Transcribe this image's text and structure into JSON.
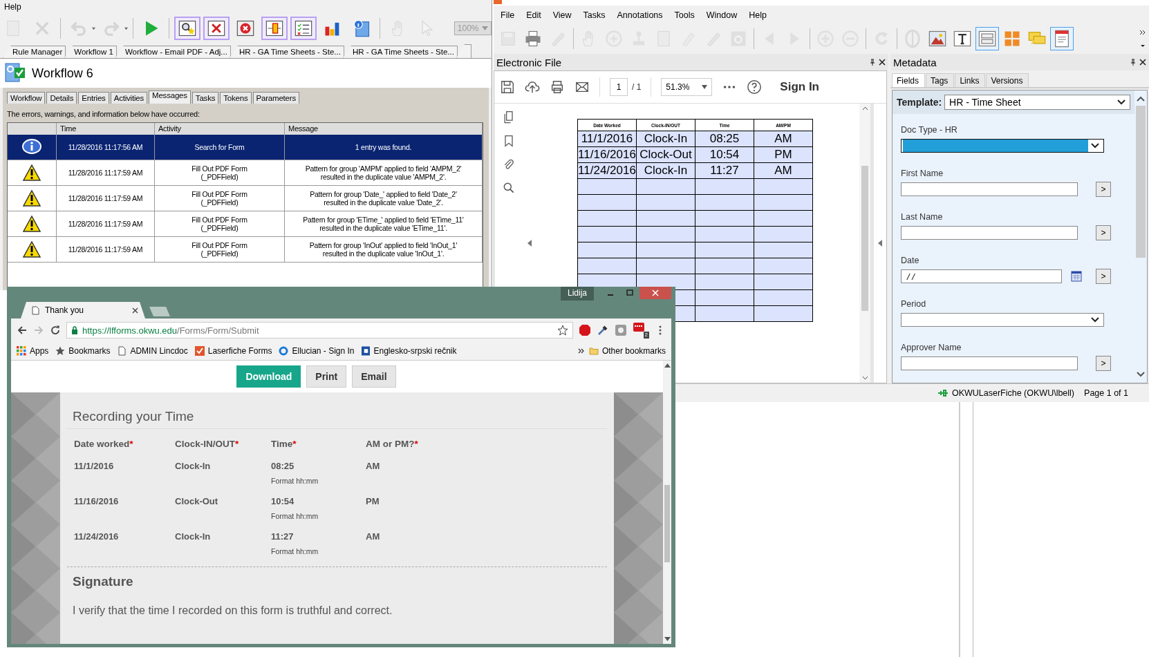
{
  "workflow_window": {
    "menu": [
      "Help"
    ],
    "toolbar": [
      {
        "kind": "page",
        "disabled": true,
        "active": false
      },
      {
        "kind": "cross",
        "disabled": true,
        "active": false
      },
      {
        "kind": "separator"
      },
      {
        "kind": "undo",
        "disabled": true,
        "active": false
      },
      {
        "kind": "redo",
        "disabled": true,
        "active": false
      },
      {
        "kind": "separator"
      },
      {
        "kind": "play",
        "disabled": false,
        "active": false
      },
      {
        "kind": "separator"
      },
      {
        "kind": "find",
        "disabled": false,
        "active": true
      },
      {
        "kind": "tools",
        "disabled": false,
        "active": true
      },
      {
        "kind": "stop",
        "disabled": false,
        "active": false
      },
      {
        "kind": "flow",
        "disabled": false,
        "active": true
      },
      {
        "kind": "checklist",
        "disabled": false,
        "active": true
      },
      {
        "kind": "chart",
        "disabled": false,
        "active": false
      },
      {
        "kind": "info",
        "disabled": false,
        "active": false
      },
      {
        "kind": "separator"
      },
      {
        "kind": "hand",
        "disabled": true,
        "active": false
      },
      {
        "kind": "pointer",
        "disabled": true,
        "active": false
      }
    ],
    "zoom": "100%",
    "doc_tabs": [
      "Rule Manager",
      "Workflow 1",
      "Workflow - Email PDF - Adj...",
      "HR - GA Time Sheets - Ste...",
      "HR - GA Time Sheets - Ste..."
    ],
    "title": "Workflow 6",
    "tabs": [
      {
        "label": "Workflow",
        "selected": false
      },
      {
        "label": "Details",
        "selected": false
      },
      {
        "label": "Entries",
        "selected": false
      },
      {
        "label": "Activities",
        "selected": false
      },
      {
        "label": "Messages",
        "selected": true
      },
      {
        "label": "Tasks",
        "selected": false
      },
      {
        "label": "Tokens",
        "selected": false
      },
      {
        "label": "Parameters",
        "selected": false
      }
    ],
    "notice": "The errors, warnings, and information below have occurred:",
    "table": {
      "columns": [
        "Time",
        "Activity",
        "Message"
      ],
      "rows": [
        {
          "kind": "info",
          "selected": true,
          "time": "11/28/2016 11:17:56 AM",
          "activity": "Search for Form",
          "message": "1 entry was found."
        },
        {
          "kind": "warning",
          "selected": false,
          "time": "11/28/2016 11:17:59 AM",
          "activity": "Fill Out PDF Form\n(_PDFField)",
          "message": "Pattern for group 'AMPM' applied to field 'AMPM_2'\nresulted in the duplicate value 'AMPM_2'."
        },
        {
          "kind": "warning",
          "selected": false,
          "time": "11/28/2016 11:17:59 AM",
          "activity": "Fill Out PDF Form\n(_PDFField)",
          "message": "Pattern for group 'Date_' applied to field 'Date_2'\nresulted in the duplicate value 'Date_2'."
        },
        {
          "kind": "warning",
          "selected": false,
          "time": "11/28/2016 11:17:59 AM",
          "activity": "Fill Out PDF Form\n(_PDFField)",
          "message": "Pattern for group 'ETime_' applied to field 'ETime_11'\nresulted in the duplicate value 'ETime_11'."
        },
        {
          "kind": "warning",
          "selected": false,
          "time": "11/28/2016 11:17:59 AM",
          "activity": "Fill Out PDF Form\n(_PDFField)",
          "message": "Pattern for group 'InOut' applied to field 'InOut_1'\nresulted in the duplicate value 'InOut_1'."
        }
      ]
    }
  },
  "laserfiche_window": {
    "menu": [
      "File",
      "Edit",
      "View",
      "Tasks",
      "Annotations",
      "Tools",
      "Window",
      "Help"
    ],
    "toolbar": [
      {
        "kind": "save",
        "disabled": true,
        "active": false
      },
      {
        "kind": "print",
        "disabled": false,
        "active": false
      },
      {
        "kind": "pencil",
        "disabled": true,
        "active": false
      },
      {
        "kind": "separator"
      },
      {
        "kind": "hand",
        "disabled": true,
        "active": false
      },
      {
        "kind": "zoomin",
        "disabled": true,
        "active": false
      },
      {
        "kind": "stamp",
        "disabled": true,
        "active": false
      },
      {
        "kind": "page",
        "disabled": true,
        "active": false
      },
      {
        "kind": "highlighter",
        "disabled": true,
        "active": false
      },
      {
        "kind": "pencil",
        "disabled": true,
        "active": false
      },
      {
        "kind": "textbox",
        "disabled": true,
        "active": false
      },
      {
        "kind": "separator"
      },
      {
        "kind": "back",
        "disabled": true,
        "active": false
      },
      {
        "kind": "forward",
        "disabled": true,
        "active": false
      },
      {
        "kind": "separator"
      },
      {
        "kind": "plus",
        "disabled": true,
        "active": false
      },
      {
        "kind": "minus",
        "disabled": true,
        "active": false
      },
      {
        "kind": "separator"
      },
      {
        "kind": "rotate",
        "disabled": true,
        "active": false
      },
      {
        "kind": "separator"
      },
      {
        "kind": "oval",
        "disabled": true,
        "active": false
      },
      {
        "kind": "picture",
        "disabled": false,
        "active": false
      },
      {
        "kind": "text",
        "disabled": false,
        "active": false
      },
      {
        "kind": "fields",
        "disabled": false,
        "active": true
      },
      {
        "kind": "tiles",
        "disabled": false,
        "active": false
      },
      {
        "kind": "comments",
        "disabled": false,
        "active": false
      },
      {
        "kind": "document",
        "disabled": false,
        "active": true
      }
    ],
    "electronic_file": {
      "title": "Electronic File",
      "page": "1",
      "page_total": "/ 1",
      "zoom": "51.3%",
      "sign_in": "Sign In",
      "pdf_table": {
        "columns": [
          "Date Worked",
          "Clock-IN/OUT",
          "Time",
          "AM/PM"
        ],
        "rows": [
          [
            "11/1/2016",
            "Clock-In",
            "08:25",
            "AM"
          ],
          [
            "11/16/2016",
            "Clock-Out",
            "10:54",
            "PM"
          ],
          [
            "11/24/2016",
            "Clock-In",
            "11:27",
            "AM"
          ]
        ]
      }
    },
    "metadata": {
      "title": "Metadata",
      "tabs": [
        {
          "label": "Fields",
          "selected": true
        },
        {
          "label": "Tags",
          "selected": false
        },
        {
          "label": "Links",
          "selected": false
        },
        {
          "label": "Versions",
          "selected": false
        }
      ],
      "template_label": "Template:",
      "template": "HR - Time Sheet",
      "fields": [
        {
          "kind": "select",
          "label": "Doc Type - HR",
          "focused": true
        },
        {
          "kind": "text",
          "label": "First Name",
          "focused": false,
          "button": ">"
        },
        {
          "kind": "text",
          "label": "Last Name",
          "focused": false,
          "button": ">"
        },
        {
          "kind": "date",
          "label": "Date",
          "focused": false,
          "value": "/ /",
          "button": ">"
        },
        {
          "kind": "select",
          "label": "Period",
          "focused": false
        },
        {
          "kind": "text",
          "label": "Approver Name",
          "focused": false,
          "button": ">"
        }
      ]
    },
    "status_bar": {
      "connection": "OKWULaserFiche (OKWU\\lbell)",
      "page": "Page 1 of 1"
    }
  },
  "browser_window": {
    "profile": "Lidija",
    "tabs": [
      {
        "label": "Thank you",
        "selected": true
      }
    ],
    "url_host": "https://lfforms.okwu.edu",
    "url_path": "/Forms/Form/Submit",
    "extension_badge": "2",
    "bookmarks": [
      {
        "kind": "apps",
        "label": "Apps"
      },
      {
        "kind": "star",
        "label": "Bookmarks"
      },
      {
        "kind": "page",
        "label": "ADMIN Lincdoc"
      },
      {
        "kind": "check",
        "label": "Laserfiche Forms"
      },
      {
        "kind": "ring",
        "label": "Ellucian - Sign In"
      },
      {
        "kind": "square",
        "label": "Englesko-srpski rečnik"
      }
    ],
    "other_bookmarks": "Other bookmarks",
    "buttons": [
      {
        "label": "Download",
        "primary": true
      },
      {
        "label": "Print",
        "primary": false
      },
      {
        "label": "Email",
        "primary": false
      }
    ],
    "form": {
      "section": "Recording your Time",
      "required_mark": "*",
      "columns": [
        {
          "label": "Date worked",
          "required": true
        },
        {
          "label": "Clock-IN/OUT",
          "required": true
        },
        {
          "label": "Time",
          "required": true
        },
        {
          "label": "AM  or PM?",
          "required": true
        }
      ],
      "rows": [
        {
          "date": "11/1/2016",
          "clock": "Clock-In",
          "time": "08:25",
          "hint": "Format hh:mm",
          "ampm": "AM"
        },
        {
          "date": "11/16/2016",
          "clock": "Clock-Out",
          "time": "10:54",
          "hint": "Format hh:mm",
          "ampm": "PM"
        },
        {
          "date": "11/24/2016",
          "clock": "Clock-In",
          "time": "11:27",
          "hint": "Format hh:mm",
          "ampm": "AM"
        }
      ],
      "signature_title": "Signature",
      "signature_text": "I verify that the time I recorded on this form is truthful and correct."
    }
  }
}
